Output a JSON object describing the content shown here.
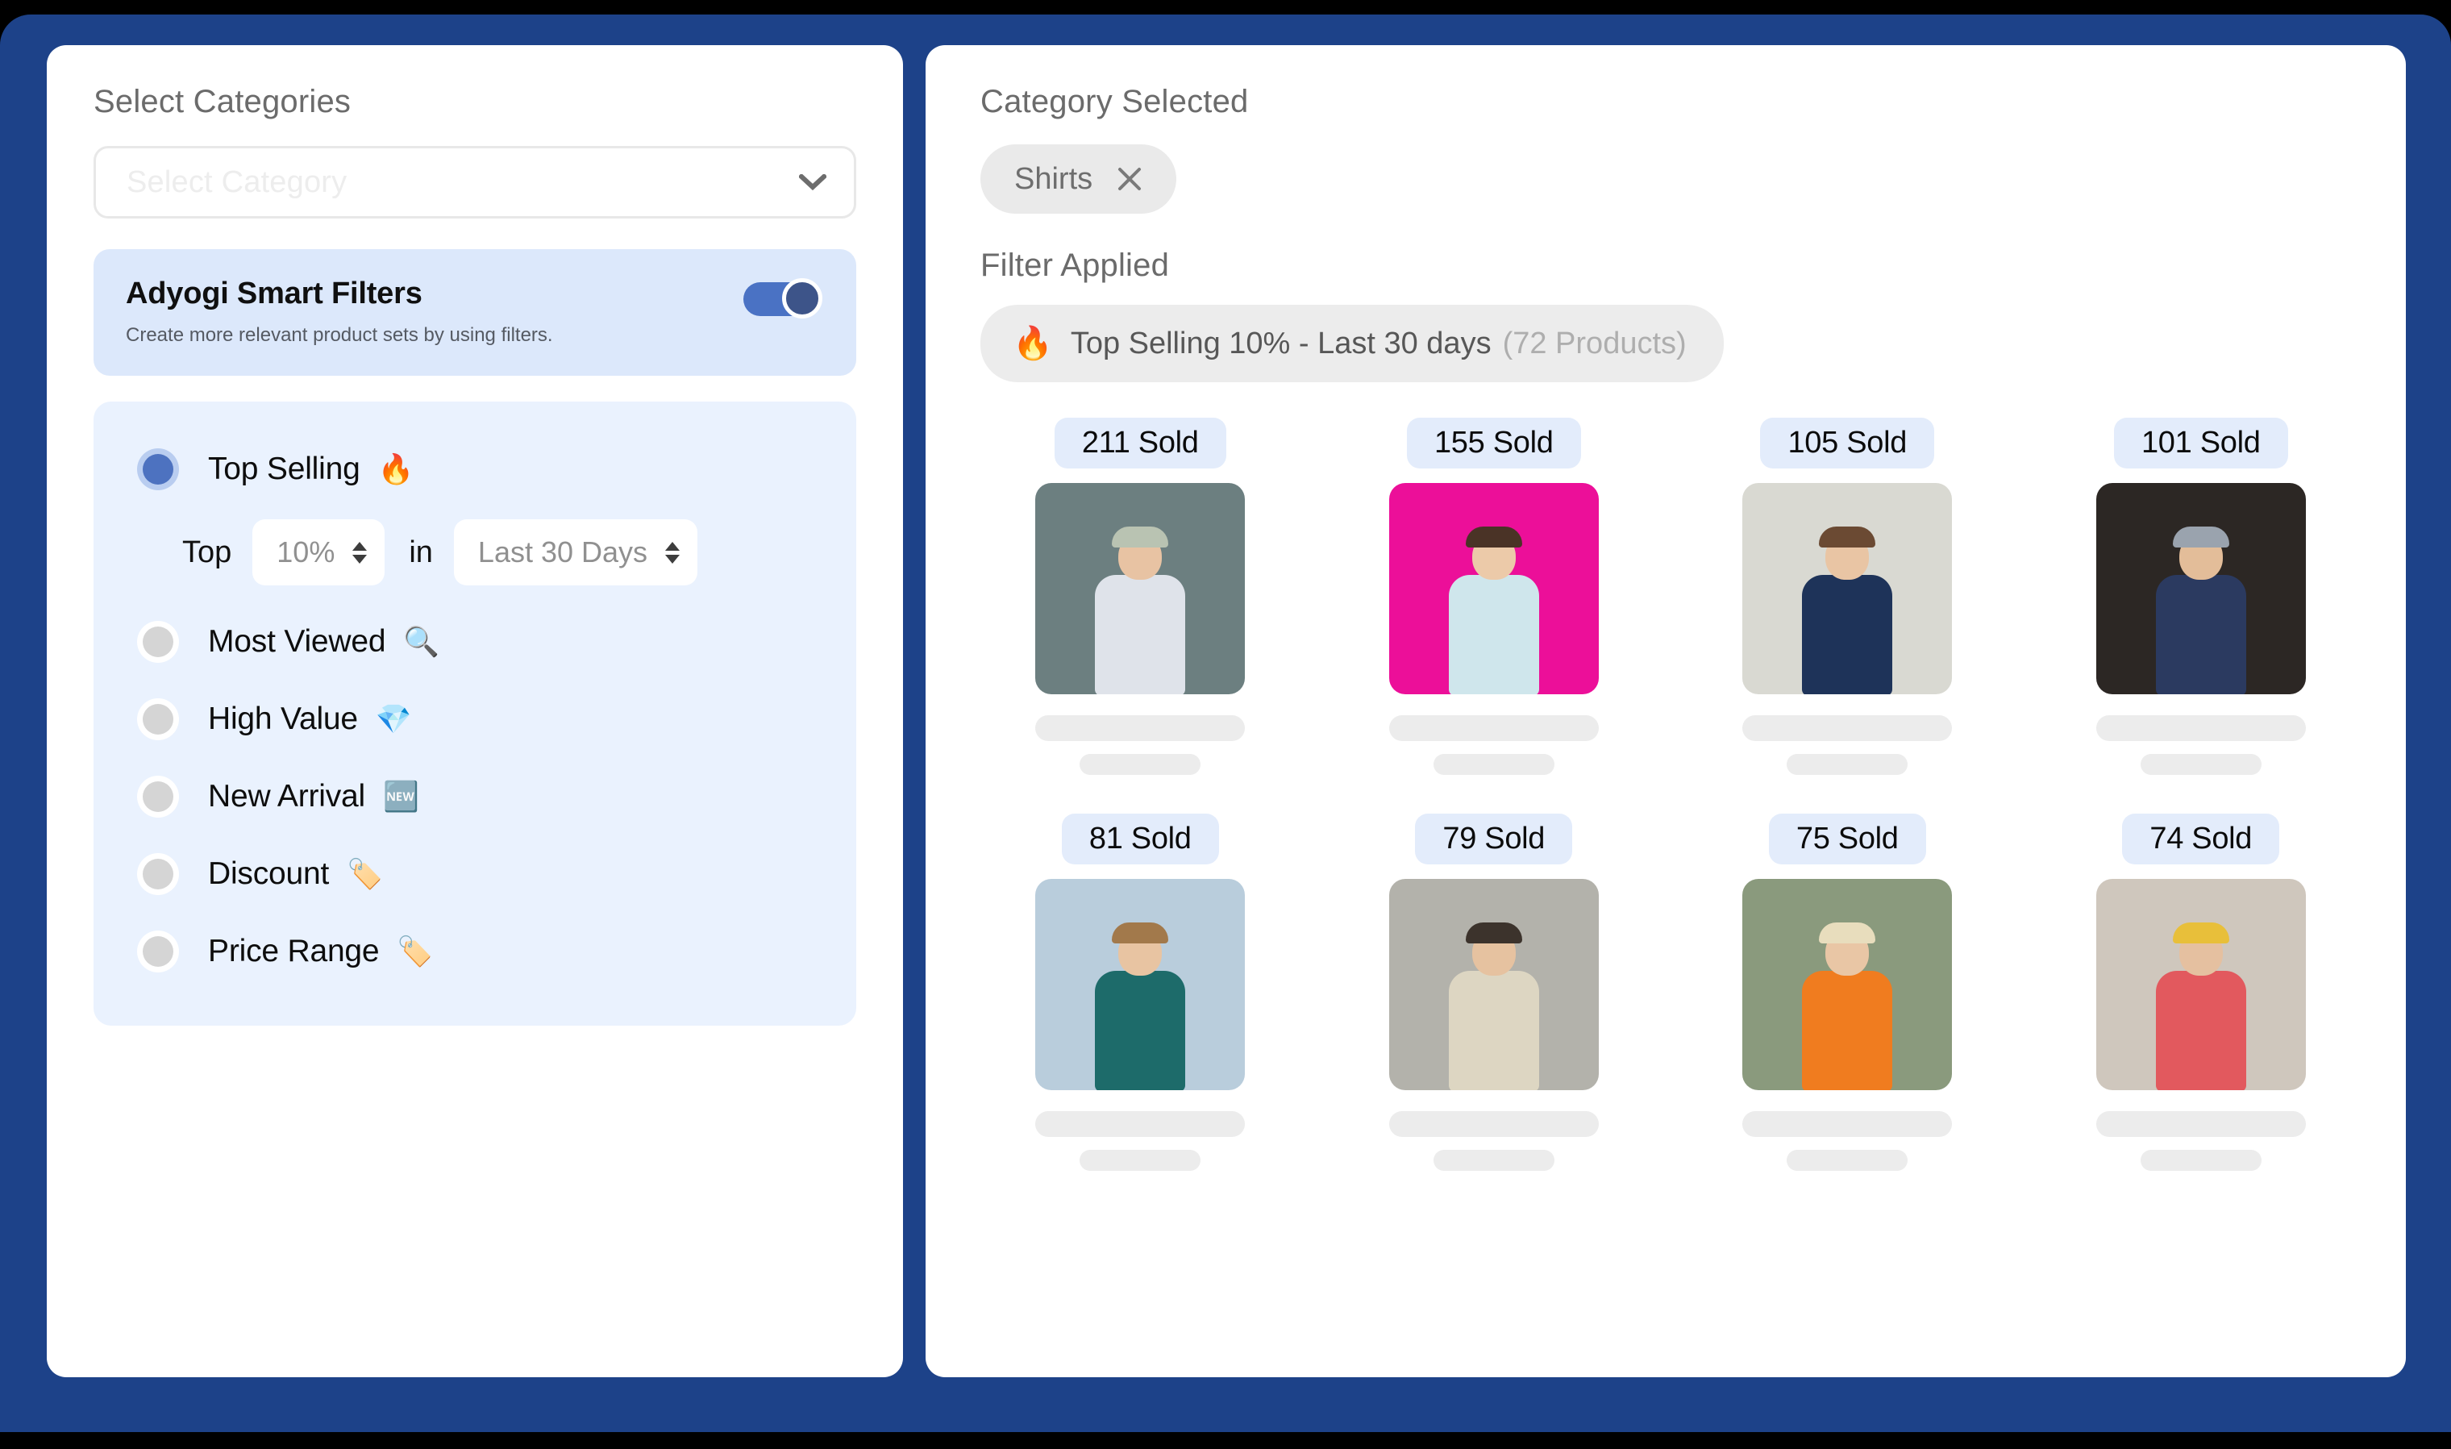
{
  "left_panel": {
    "section_label": "Select Categories",
    "category_select": {
      "placeholder": "Select Category",
      "value": "",
      "icon": "chevron-down-icon"
    },
    "smart_filters": {
      "title": "Adyogi Smart Filters",
      "subtitle": "Create more relevant product sets by using filters.",
      "toggle_state": "on",
      "toggle_track_color": "#4a72c4",
      "toggle_knob_color": "#3d5489",
      "background_color": "#dce8fb"
    },
    "filter_options_background": "#eaf2fe",
    "filter_options": [
      {
        "label": "Top Selling",
        "emoji": "🔥",
        "icon": "fire-icon",
        "selected": true
      },
      {
        "label": "Most Viewed",
        "emoji": "🔍",
        "icon": "magnifying-glass-icon",
        "selected": false
      },
      {
        "label": "High Value",
        "emoji": "💎",
        "icon": "gem-icon",
        "selected": false
      },
      {
        "label": "New Arrival",
        "emoji": "🆕",
        "icon": "new-badge-icon",
        "selected": false
      },
      {
        "label": "Discount",
        "emoji": "🏷️",
        "icon": "discount-tag-icon",
        "selected": false
      },
      {
        "label": "Price Range",
        "emoji": "🏷️",
        "icon": "price-tag-icon",
        "selected": false
      }
    ],
    "top_selling_controls": {
      "prefix_label": "Top",
      "percent_value": "10%",
      "middle_label": "in",
      "period_value": "Last 30 Days"
    }
  },
  "right_panel": {
    "category_selected_label": "Category Selected",
    "selected_category_chip": {
      "label": "Shirts",
      "remove_icon": "close-icon"
    },
    "filter_applied_label": "Filter Applied",
    "applied_filter_chip": {
      "emoji": "🔥",
      "icon": "fire-icon",
      "text": "Top Selling 10% - Last 30 days",
      "count": "(72 Products)"
    },
    "products": [
      {
        "sold_label": "211 Sold",
        "sold": 211,
        "bg": "#6c7f80",
        "hat": "#b9c3b2",
        "skin": "#e8c3a3",
        "shirt": "#dfe3ea"
      },
      {
        "sold_label": "155 Sold",
        "sold": 155,
        "bg": "#ec0f99",
        "hat": "",
        "skin": "#eccaa9",
        "shirt": "#cfe6ec"
      },
      {
        "sold_label": "105 Sold",
        "sold": 105,
        "bg": "#d9d9d2",
        "hat": "",
        "skin": "#e9c5a4",
        "shirt": "#1e3359"
      },
      {
        "sold_label": "101 Sold",
        "sold": 101,
        "bg": "#2c2724",
        "hat": "#9aa3ae",
        "skin": "#e3bd99",
        "shirt": "#2b3a60"
      },
      {
        "sold_label": "81 Sold",
        "sold": 81,
        "bg": "#b9cddc",
        "hat": "",
        "skin": "#e8c4a2",
        "shirt": "#1d6b6a"
      },
      {
        "sold_label": "79 Sold",
        "sold": 79,
        "bg": "#b3b2ab",
        "hat": "",
        "skin": "#e6c2a0",
        "shirt": "#ddd6c2"
      },
      {
        "sold_label": "75 Sold",
        "sold": 75,
        "bg": "#8a9a7d",
        "hat": "#e8ddbd",
        "skin": "#e9c6a5",
        "shirt": "#f07c1f"
      },
      {
        "sold_label": "74 Sold",
        "sold": 74,
        "bg": "#cfc7bd",
        "hat": "#e8bf3a",
        "skin": "#e5c0a0",
        "shirt": "#e2595e"
      }
    ]
  },
  "theme": {
    "frame_color": "#1d4289",
    "panel_color": "#ffffff",
    "badge_bg": "#e3ecfb",
    "chip_bg": "#ececec"
  }
}
